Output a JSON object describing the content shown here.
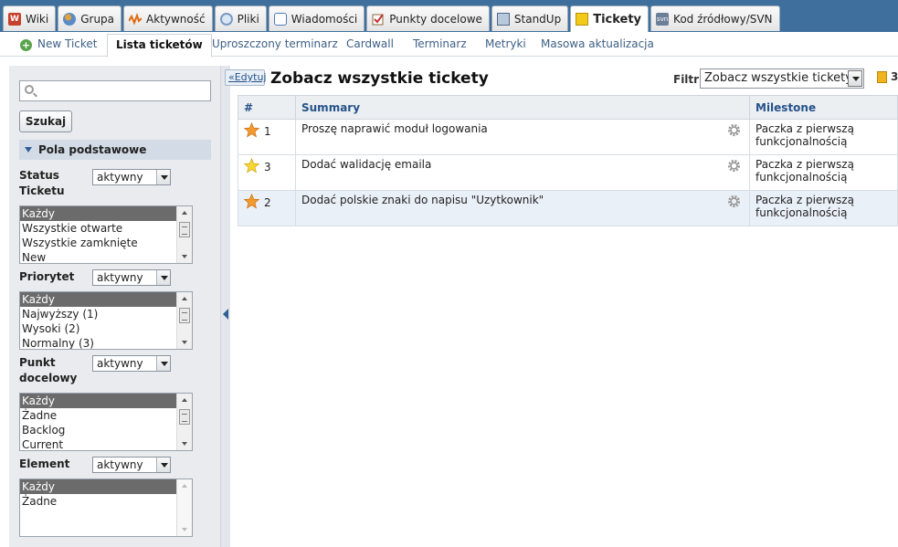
{
  "tabs": [
    {
      "label": "Wiki",
      "icon": "wiki-icon"
    },
    {
      "label": "Grupa",
      "icon": "group-icon"
    },
    {
      "label": "Aktywność",
      "icon": "activity-icon"
    },
    {
      "label": "Pliki",
      "icon": "files-icon"
    },
    {
      "label": "Wiadomości",
      "icon": "messages-icon"
    },
    {
      "label": "Punkty docelowe",
      "icon": "milestones-icon"
    },
    {
      "label": "StandUp",
      "icon": "standup-icon"
    },
    {
      "label": "Tickety",
      "icon": "tickets-icon",
      "active": true
    },
    {
      "label": "Kod źródłowy/SVN",
      "icon": "svn-icon"
    }
  ],
  "subnav": {
    "new_ticket": "New Ticket",
    "ticket_list": "Lista ticketów",
    "simple_schedule": "Uproszczony terminarz",
    "cardwall": "Cardwall",
    "schedule": "Terminarz",
    "metrics": "Metryki",
    "bulk_update": "Masowa aktualizacja"
  },
  "sidebar": {
    "search_placeholder": "",
    "search_button": "Szukaj",
    "section_title": "Pola podstawowe",
    "filters": [
      {
        "label": "Status Ticketu",
        "select": "aktywny",
        "options": [
          "Każdy",
          "Wszystkie otwarte",
          "Wszystkie zamknięte",
          "New"
        ]
      },
      {
        "label": "Priorytet",
        "select": "aktywny",
        "options": [
          "Każdy",
          "Najwyższy (1)",
          "Wysoki (2)",
          "Normalny (3)"
        ]
      },
      {
        "label": "Punkt docelowy",
        "select": "aktywny",
        "options": [
          "Każdy",
          "Żadne",
          "Backlog",
          "Current"
        ]
      },
      {
        "label": "Element",
        "select": "aktywny",
        "options": [
          "Każdy",
          "Żadne"
        ]
      }
    ]
  },
  "main": {
    "edit_label": "«Edytuj",
    "title": "Zobacz wszystkie tickety",
    "filter_label": "Filtr",
    "filter_value": "Zobacz wszystkie tickety",
    "rss_count": "3",
    "columns": [
      "#",
      "Summary",
      "Milestone"
    ],
    "rows": [
      {
        "star": "orange",
        "id": "1",
        "summary": "Proszę naprawić moduł logowania",
        "milestone": "Paczka z pierwszą funkcjonalnością"
      },
      {
        "star": "yellow",
        "id": "3",
        "summary": "Dodać walidację emaila",
        "milestone": "Paczka z pierwszą funkcjonalnością"
      },
      {
        "star": "orange",
        "id": "2",
        "summary": "Dodać polskie znaki do napisu \"Uzytkownik\"",
        "milestone": "Paczka z pierwszą funkcjonalnością"
      }
    ]
  },
  "colors": {
    "topbar": "#3f6f9c",
    "link": "#3d5f85",
    "sidebar_bg": "#e9ebee",
    "star_orange": "#f39a2e",
    "star_yellow": "#f7d635",
    "highlight_row": "#eaf0f7"
  }
}
